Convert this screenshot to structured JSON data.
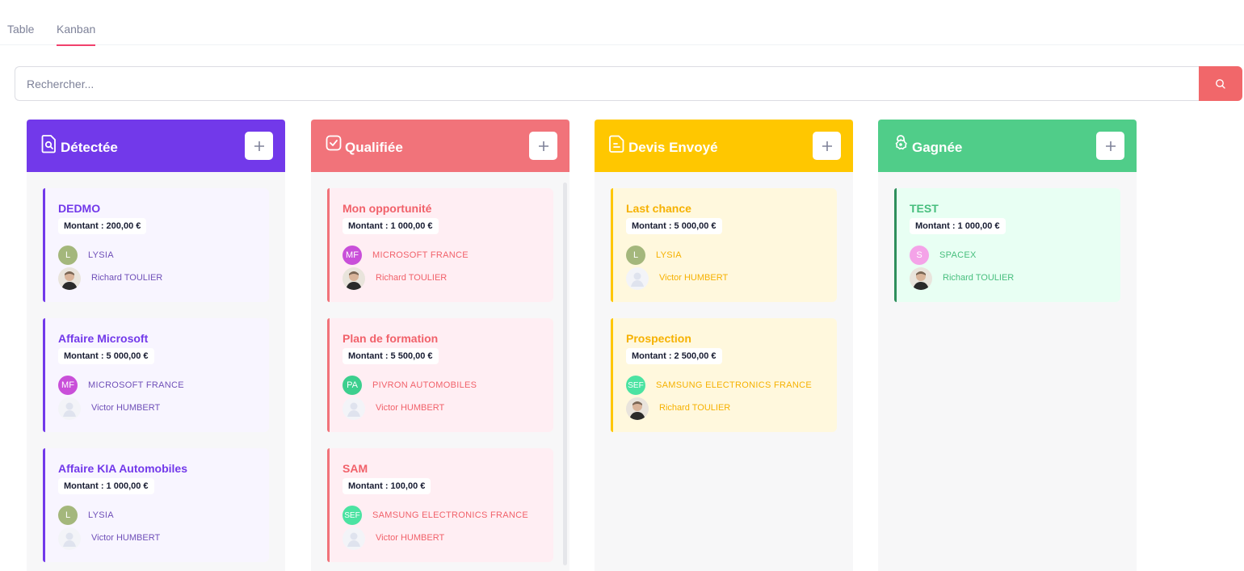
{
  "tabs": [
    {
      "label": "Table",
      "active": false
    },
    {
      "label": "Kanban",
      "active": true
    }
  ],
  "search": {
    "placeholder": "Rechercher...",
    "icon": "search-icon"
  },
  "colors": {
    "detectee": "#7239ea",
    "detectee_card": "#f8f5ff",
    "detectee_text": "#7239ea",
    "detectee_sub": "#6f4fb8",
    "qualifiee": "#f1737a",
    "qualifiee_card": "#ffeef3",
    "qualifiee_text": "#f1616a",
    "devis": "#ffc700",
    "devis_card": "#fff8dd",
    "devis_text": "#f6b100",
    "gagnee": "#50cd89",
    "gagnee_card": "#e8fff3",
    "gagnee_text": "#47be7d",
    "search_button": "#f1676a",
    "active_tab": "#f1416c"
  },
  "columns": [
    {
      "title": "Détectée",
      "icon": "document-search-icon",
      "add_label": "+",
      "cards": [
        {
          "title": "DEDMO",
          "amount": "Montant : 200,00 €",
          "company_badge": "L",
          "company": "LYSIA",
          "person": "Richard TOULIER",
          "person_avatar": "photo"
        },
        {
          "title": "Affaire Microsoft",
          "amount": "Montant : 5 000,00 €",
          "company_badge": "MF",
          "company": "MICROSOFT FRANCE",
          "person": "Victor HUMBERT",
          "person_avatar": "blank"
        },
        {
          "title": "Affaire KIA Automobiles",
          "amount": "Montant : 1 000,00 €",
          "company_badge": "L",
          "company": "LYSIA",
          "person": "Victor HUMBERT",
          "person_avatar": "blank"
        }
      ]
    },
    {
      "title": "Qualifiée",
      "icon": "check-square-icon",
      "add_label": "+",
      "cards": [
        {
          "title": "Mon opportunité",
          "amount": "Montant : 1 000,00 €",
          "company_badge": "MF",
          "company": "MICROSOFT FRANCE",
          "person": "Richard TOULIER",
          "person_avatar": "photo"
        },
        {
          "title": "Plan de formation",
          "amount": "Montant : 5 500,00 €",
          "company_badge": "PA",
          "company": "PIVRON AUTOMOBILES",
          "person": "Victor HUMBERT",
          "person_avatar": "blank"
        },
        {
          "title": "SAM",
          "amount": "Montant : 100,00 €",
          "company_badge": "SEF",
          "company": "SAMSUNG ELECTRONICS FRANCE",
          "person": "Victor HUMBERT",
          "person_avatar": "blank"
        }
      ]
    },
    {
      "title": "Devis Envoyé",
      "icon": "document-text-icon",
      "add_label": "+",
      "cards": [
        {
          "title": "Last chance",
          "amount": "Montant : 5 000,00 €",
          "company_badge": "L",
          "company": "LYSIA",
          "person": "Victor HUMBERT",
          "person_avatar": "blank"
        },
        {
          "title": "Prospection",
          "amount": "Montant : 2 500,00 €",
          "company_badge": "SEF",
          "company": "SAMSUNG ELECTRONICS FRANCE",
          "person": "Richard TOULIER",
          "person_avatar": "photo"
        }
      ]
    },
    {
      "title": "Gagnée",
      "icon": "lock-badge-icon",
      "add_label": "+",
      "cards": [
        {
          "title": "TEST",
          "amount": "Montant : 1 000,00 €",
          "company_badge": "S",
          "company": "SPACEX",
          "person": "Richard TOULIER",
          "person_avatar": "photo"
        }
      ]
    }
  ]
}
